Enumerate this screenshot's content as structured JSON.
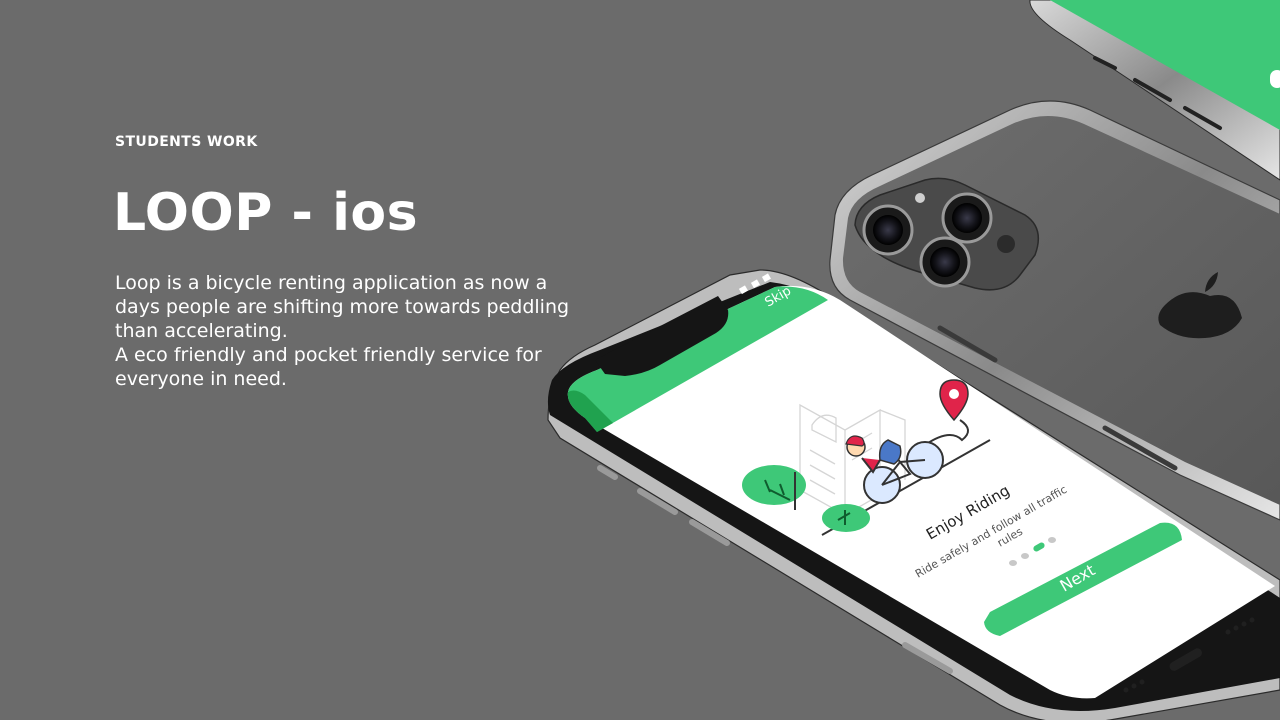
{
  "eyebrow": "STUDENTS WORK",
  "title": "LOOP - ios",
  "description": {
    "para1": "Loop is a bicycle renting application as now a days people are shifting more towards peddling than accelerating.",
    "para2": "A eco friendly and pocket friendly service for everyone in need."
  },
  "phone_screen": {
    "skip_label": "Skip",
    "heading": "Enjoy Riding",
    "subtitle_line1": "Ride safely and follow all traffic",
    "subtitle_line2": "rules",
    "next_label": "Next",
    "pager": {
      "total": 4,
      "active": 3
    }
  },
  "colors": {
    "background": "#6b6b6b",
    "brand_green": "#3ec878",
    "dark_green": "#20a24f",
    "pin_red": "#e0244a"
  }
}
